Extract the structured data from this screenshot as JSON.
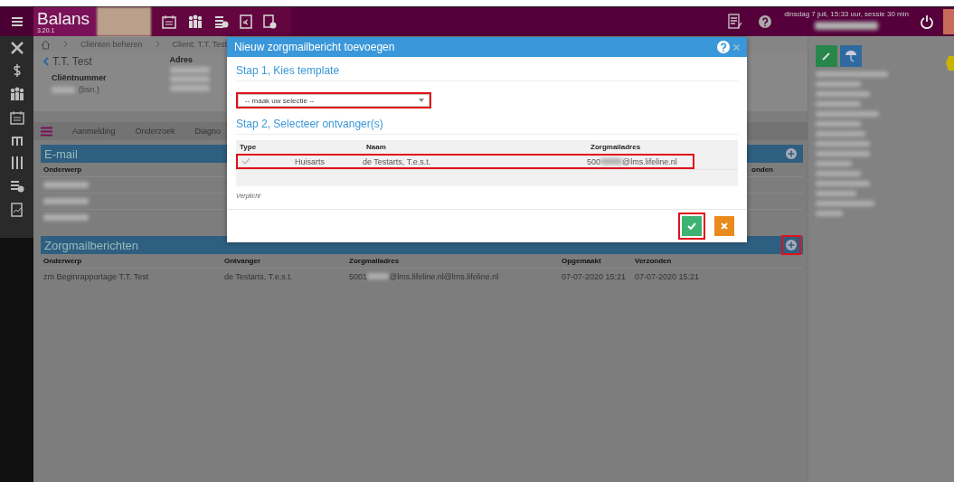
{
  "topbar": {
    "brand": "Balans",
    "version": "3.20.1",
    "session": "dinsdag 7 juli, 15:33 uur, sessie 30 min"
  },
  "breadcrumb": [
    "Cliënten beheren",
    "Client: T.T. Test"
  ],
  "client": {
    "name": "T.T. Test",
    "number_label": "Cliëntnummer",
    "number_suffix": "(bsn.)",
    "address_label": "Adres"
  },
  "tabs": [
    {
      "label": "Aanmelding",
      "selected": false
    },
    {
      "label": "Onderzoek",
      "selected": false
    },
    {
      "label": "Diagno",
      "selected": false
    }
  ],
  "email_section": {
    "title": "E-mail",
    "columns": [
      "Onderwerp"
    ],
    "right_column": "onden",
    "highlighted": false
  },
  "zorgmail_section": {
    "title": "Zorgmailberichten",
    "highlighted": true,
    "columns": [
      "Onderwerp",
      "Ontvanger",
      "Zorgmailadres",
      "Opgemaakt",
      "Verzonden"
    ],
    "rows": [
      {
        "subject": "zm Beginrapportage T.T. Test",
        "recipient": "de Testarts, T.e.s.t.",
        "address_start": "5001",
        "address_end": "@lms.lifeline.nl@lms.lifeline.nl",
        "created": "07-07-2020 15:21",
        "sent": "07-07-2020 15:21"
      }
    ]
  },
  "dialog": {
    "title": "Nieuw zorgmailbericht toevoegen",
    "step1": "Stap 1, Kies template",
    "select": {
      "value": "-- maak uw selectie --",
      "highlighted": true
    },
    "step2": "Stap 2, Selecteer ontvanger(s)",
    "columns": [
      "Type",
      "Naam",
      "Zorgmailadres"
    ],
    "recipients": [
      {
        "checked": true,
        "highlighted": true,
        "type": "Huisarts",
        "name": "de Testarts, T.e.s.t.",
        "address_start": "500",
        "address_end": "@lms.lifeline.nl"
      }
    ],
    "required_note": "Verplicht",
    "confirm": {
      "highlighted": true
    },
    "cancel": {
      "highlighted": false
    }
  }
}
